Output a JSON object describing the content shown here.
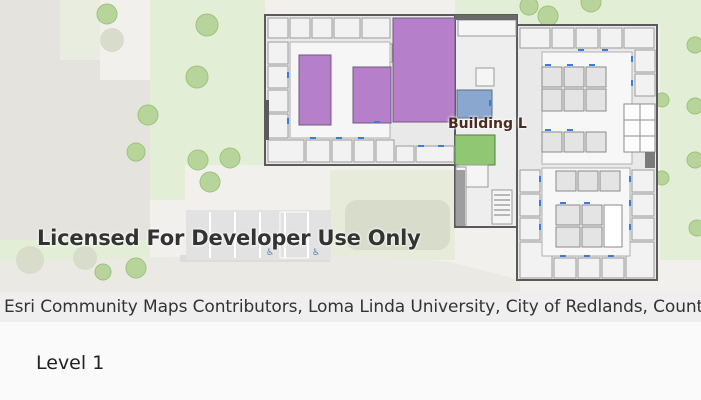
{
  "map": {
    "watermark": "Licensed For Developer Use Only",
    "building_label": "Building L",
    "colors": {
      "background": "#f1f0ec",
      "grass": "#e3eed6",
      "tree": "#b7d59a",
      "parking": "#e2e2e2",
      "floor": "#e9e9e9",
      "room": "#f2f2f2",
      "wall": "#5a5a5a",
      "purple_room": "#b57fc9",
      "blue_room": "#8aa7cf",
      "green_room": "#8fc773",
      "door": "#3d7bd9"
    }
  },
  "attribution": {
    "text": "Esri Community Maps Contributors, Loma Linda University, City of Redlands, County of San Bernardino"
  },
  "floor_panel": {
    "level": "Level 1"
  }
}
